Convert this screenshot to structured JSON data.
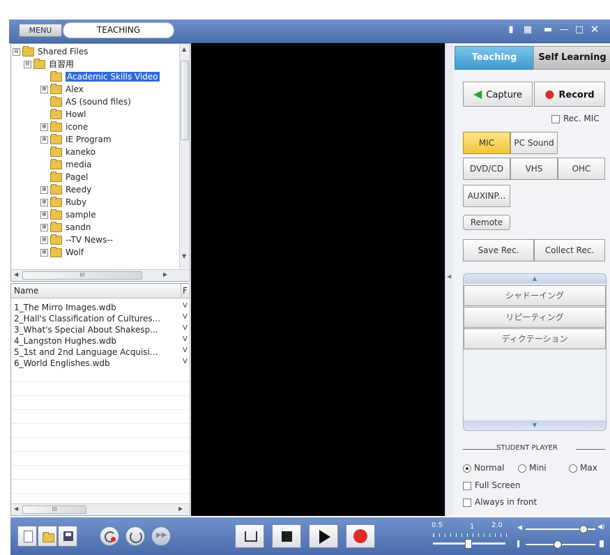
{
  "title_bar": {
    "menu_label": "MENU",
    "mode_value": "TEACHING",
    "icons": [
      "lock-icon",
      "keyboard-icon",
      "compact-icon",
      "minimize-icon",
      "maximize-icon",
      "close-icon"
    ]
  },
  "tree": {
    "items": [
      {
        "label": "Shared Files",
        "expander": "⊟"
      },
      {
        "label": "自習用",
        "expander": "⊟"
      },
      {
        "label": "Academic Skills Video",
        "expander": "",
        "selected": true
      },
      {
        "label": "Alex",
        "expander": "⊞"
      },
      {
        "label": "AS (sound files)",
        "expander": ""
      },
      {
        "label": "Howl",
        "expander": ""
      },
      {
        "label": "icone",
        "expander": "⊞"
      },
      {
        "label": "IE Program",
        "expander": "⊞"
      },
      {
        "label": "kaneko",
        "expander": ""
      },
      {
        "label": "media",
        "expander": ""
      },
      {
        "label": "Pagel",
        "expander": ""
      },
      {
        "label": "Reedy",
        "expander": "⊞"
      },
      {
        "label": "Ruby",
        "expander": "⊞"
      },
      {
        "label": "sample",
        "expander": "⊞"
      },
      {
        "label": "sandn",
        "expander": "⊞"
      },
      {
        "label": "--TV News--",
        "expander": "⊞"
      },
      {
        "label": "Wolf",
        "expander": "⊞"
      }
    ],
    "hscroll_grip": "III"
  },
  "files": {
    "columns": [
      "Name",
      "F"
    ],
    "rows": [
      {
        "name": "1_The Mirro Images.wdb",
        "col2": "V"
      },
      {
        "name": "2_Hall's Classification of Cultures...",
        "col2": "V"
      },
      {
        "name": "3_What's Special About Shakesp...",
        "col2": "V"
      },
      {
        "name": "4_Langston Hughes.wdb",
        "col2": "V"
      },
      {
        "name": "5_1st and 2nd Language Acquisi...",
        "col2": "V"
      },
      {
        "name": "6_World Englishes.wdb",
        "col2": "V"
      }
    ],
    "hscroll_grip": "III"
  },
  "right_panel": {
    "tabs": [
      "Teaching",
      "Self Learning"
    ],
    "capture_label": "Capture",
    "record_label": "Record",
    "rec_mic_label": "Rec. MIC",
    "sources_row1": [
      "MIC",
      "PC Sound"
    ],
    "sources_row2": [
      "DVD/CD",
      "VHS",
      "OHC"
    ],
    "aux_label": "AUXINP...",
    "remote_label": "Remote",
    "save_rec_label": "Save Rec.",
    "collect_rec_label": "Collect Rec.",
    "lesson_items": [
      "シャドーイング",
      "リピーティング",
      "ディクテーション"
    ],
    "student_player_label": "STUDENT PLAYER",
    "modes": [
      "Normal",
      "Mini",
      "Max"
    ],
    "selected_mode": "Normal",
    "full_screen_label": "Full Screen",
    "always_front_label": "Always in front"
  },
  "bottom_bar": {
    "speed_labels": [
      "0.5",
      "1",
      "2.0"
    ],
    "speed_value": 1.0,
    "volume_level": 0.82,
    "balance_level": 0.45
  },
  "colors": {
    "accent_tab": "#52a9d8",
    "selection": "#2f6cd6",
    "mic_active": "#f4d25c",
    "record_red": "#e02b2b",
    "capture_green": "#2f9e3d"
  }
}
